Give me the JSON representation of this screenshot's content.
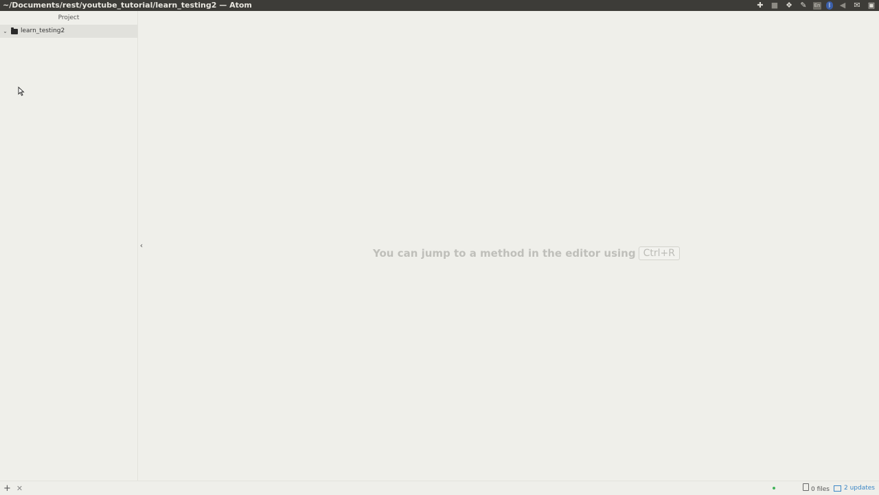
{
  "window": {
    "title": "~/Documents/rest/youtube_tutorial/learn_testing2 — Atom"
  },
  "tray": {
    "icons": [
      "plus-cross-icon",
      "camera-icon",
      "dropbox-icon",
      "edit-icon",
      "keyboard-layout-icon",
      "bluetooth-icon",
      "volume-icon",
      "mail-icon",
      "display-icon"
    ],
    "keyboard_layout": "En"
  },
  "tree_view": {
    "header": "Project",
    "root_folder": "learn_testing2"
  },
  "editor": {
    "hint_text": "You can jump to a method in the editor using",
    "hint_shortcut": "Ctrl+R"
  },
  "status_bar": {
    "files_label": "0 files",
    "updates_label": "2 updates"
  },
  "colors": {
    "titlebar_bg": "#3d3c38",
    "panel_bg": "#efefea",
    "selected_row_bg": "#e1e1dc",
    "status_green": "#42b35a",
    "updates_blue": "#3a86c6"
  }
}
